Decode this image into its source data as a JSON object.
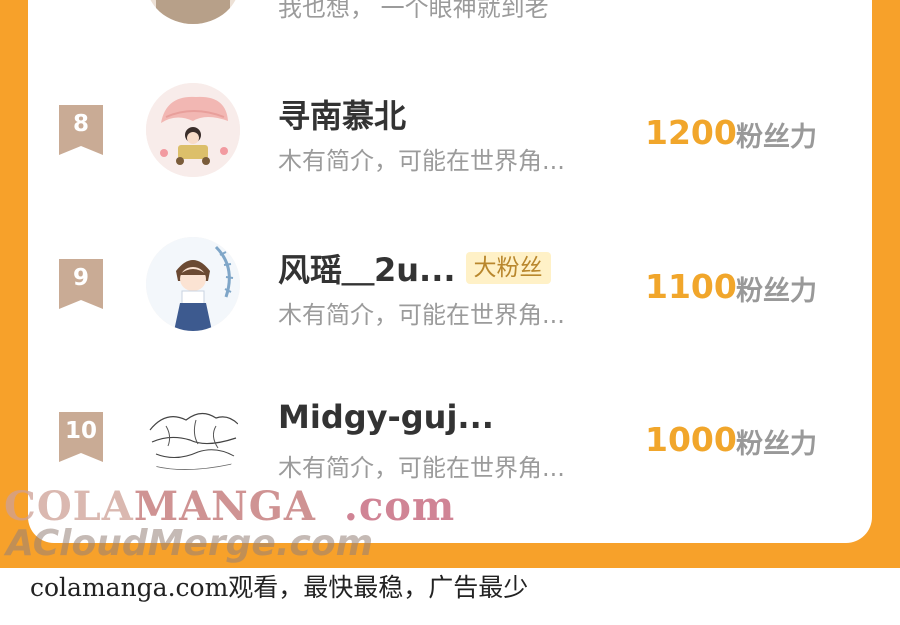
{
  "previous_row": {
    "text": "我也想，  一个眼神就到老"
  },
  "ranking": [
    {
      "rank": "8",
      "name": "寻南慕北",
      "badge": "",
      "description": "木有简介，可能在世界角...",
      "score": "1200",
      "unit": "粉丝力"
    },
    {
      "rank": "9",
      "name": "风瑶＿2u...",
      "badge": "大粉丝",
      "description": "木有简介，可能在世界角...",
      "score": "1100",
      "unit": "粉丝力"
    },
    {
      "rank": "10",
      "name": "Midgy-guj...",
      "badge": "",
      "description": "木有简介，可能在世界角...",
      "score": "1000",
      "unit": "粉丝力"
    }
  ],
  "watermark": {
    "line1_part1": "COLA",
    "line1_part2": "MANGA",
    "line1_part3": ".com",
    "line2": "ACloudMerge.com"
  },
  "footer": {
    "text": "colamanga.com观看，最快最稳，广告最少"
  },
  "colors": {
    "frame": "#f7a12a",
    "score": "#f1a62b",
    "rank_badge": "#c9ab95",
    "badge_bg": "#fff1c7"
  },
  "icons": [
    "rank-ribbon-icon",
    "avatar-image"
  ]
}
